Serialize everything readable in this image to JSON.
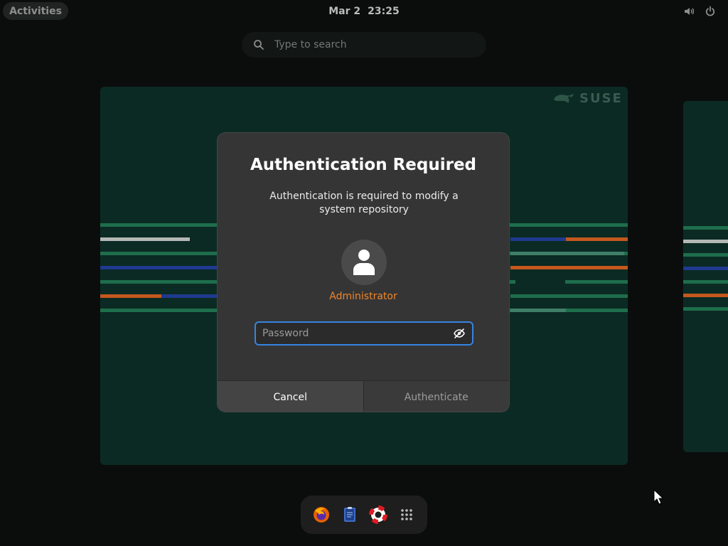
{
  "topbar": {
    "activities_label": "Activities",
    "date": "Mar 2",
    "time": "23:25",
    "icons": [
      "volume-icon",
      "power-icon"
    ]
  },
  "search": {
    "placeholder": "Type to search",
    "icon": "search-icon"
  },
  "workspace": {
    "brand": "SUSE"
  },
  "dialog": {
    "title": "Authentication Required",
    "message": "Authentication is required to modify a system repository",
    "user": "Administrator",
    "password_placeholder": "Password",
    "password_value": "",
    "cancel_label": "Cancel",
    "authenticate_label": "Authenticate",
    "authenticate_enabled": false
  },
  "dock": {
    "apps": [
      "firefox-icon",
      "text-editor-icon",
      "help-icon",
      "app-grid-icon"
    ]
  },
  "colors": {
    "accent": "#3584e4",
    "user_name": "#f0862c",
    "workspace_bg": "#0b2a23",
    "suse_green": "#30ba78"
  }
}
